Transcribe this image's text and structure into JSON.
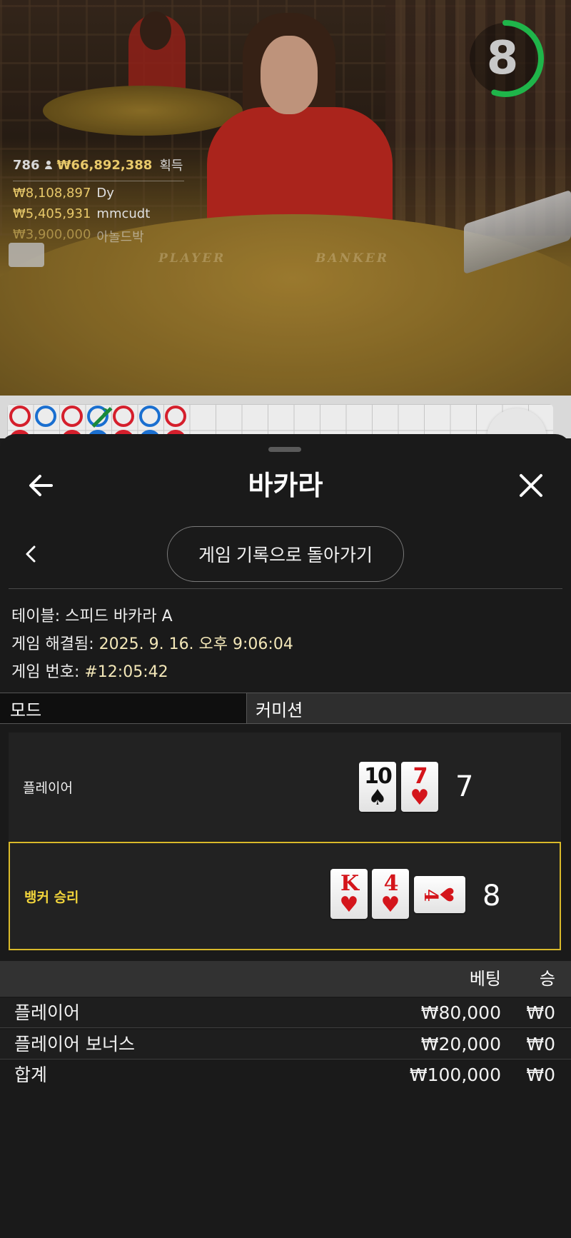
{
  "timer": {
    "seconds": "8",
    "fraction_remaining": 0.55,
    "color": "#1fb54a"
  },
  "winners": {
    "count": "786",
    "total_amount": "₩66,892,388",
    "total_suffix": "획득",
    "list": [
      {
        "amount": "₩8,108,897",
        "name": "Dy"
      },
      {
        "amount": "₩5,405,931",
        "name": "mmcudt"
      },
      {
        "amount": "₩3,900,000",
        "name": "아놀드박"
      }
    ]
  },
  "felt": {
    "player": "PLAYER",
    "banker": "BANKER"
  },
  "roadmap": {
    "tie_count": "2"
  },
  "sheet": {
    "title": "바카라",
    "back_to_history": "게임 기록으로 돌아가기"
  },
  "meta": {
    "table_label": "테이블:",
    "table_value": "스피드 바카라 A",
    "resolved_label": "게임 해결됨:",
    "resolved_value": "2025. 9. 16. 오후 9:06:04",
    "round_label": "게임 번호:",
    "round_value": "#12:05:42"
  },
  "mode": {
    "label": "모드",
    "value": "커미션"
  },
  "hands": {
    "player": {
      "label": "플레이어",
      "score": "7",
      "cards": [
        {
          "rank": "10",
          "suit": "♠"
        },
        {
          "rank": "7",
          "suit": "♥"
        }
      ]
    },
    "banker": {
      "label": "뱅커 승리",
      "score": "8",
      "cards": [
        {
          "rank": "K",
          "suit": "♥"
        },
        {
          "rank": "4",
          "suit": "♥"
        },
        {
          "rank": "4",
          "suit": "♥"
        }
      ]
    }
  },
  "bets": {
    "headers": {
      "bet": "베팅",
      "win": "승"
    },
    "rows": [
      {
        "name": "플레이어",
        "bet": "₩80,000",
        "win": "₩0"
      },
      {
        "name": "플레이어 보너스",
        "bet": "₩20,000",
        "win": "₩0"
      }
    ],
    "total": {
      "name": "합계",
      "bet": "₩100,000",
      "win": "₩0"
    }
  },
  "colors": {
    "accent_gold": "#d9b92a",
    "banker_red": "#d51f2c",
    "player_blue": "#1a6fd0"
  }
}
